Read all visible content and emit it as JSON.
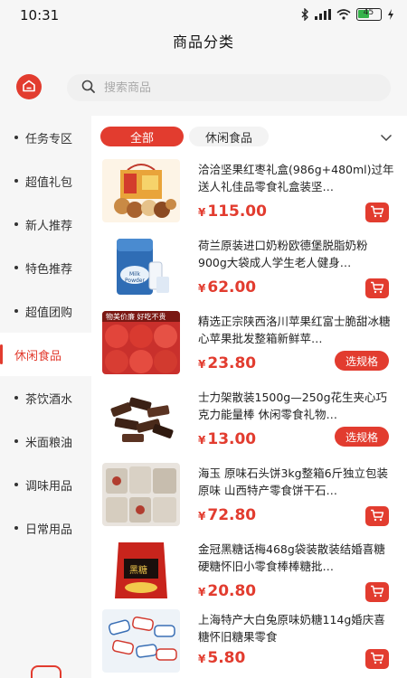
{
  "status": {
    "time": "10:31",
    "battery": "45"
  },
  "header": {
    "title": "商品分类"
  },
  "search": {
    "placeholder": "搜索商品"
  },
  "sidebar": {
    "items": [
      {
        "label": "任务专区"
      },
      {
        "label": "超值礼包"
      },
      {
        "label": "新人推荐"
      },
      {
        "label": "特色推荐"
      },
      {
        "label": "超值团购"
      },
      {
        "label": "休闲食品",
        "active": true
      },
      {
        "label": "茶饮酒水"
      },
      {
        "label": "米面粮油"
      },
      {
        "label": "调味用品"
      },
      {
        "label": "日常用品"
      }
    ]
  },
  "tabs": {
    "all": "全部",
    "current": "休闲食品"
  },
  "products": [
    {
      "title": "洽洽坚果红枣礼盒(986g+480ml)过年送人礼佳品零食礼盒装坚…",
      "currency": "¥",
      "price": "115.00",
      "action": "cart"
    },
    {
      "title": "荷兰原装进口奶粉欧德堡脱脂奶粉900g大袋成人学生老人健身…",
      "currency": "¥",
      "price": "62.00",
      "action": "cart"
    },
    {
      "title": "精选正宗陕西洛川苹果红富士脆甜冰糖心苹果批发整箱新鲜苹…",
      "currency": "¥",
      "price": "23.80",
      "action": "spec",
      "action_label": "选规格"
    },
    {
      "title": "士力架散装1500g—250g花生夹心巧克力能量棒 休闲零食礼物…",
      "currency": "¥",
      "price": "13.00",
      "action": "spec",
      "action_label": "选规格"
    },
    {
      "title": "海玉 原味石头饼3kg整箱6斤独立包装原味 山西特产零食饼干石…",
      "currency": "¥",
      "price": "72.80",
      "action": "cart"
    },
    {
      "title": "金冠黑糖话梅468g袋装散装结婚喜糖硬糖怀旧小零食棒棒糖批…",
      "currency": "¥",
      "price": "20.80",
      "action": "cart"
    },
    {
      "title": "上海特产大白兔原味奶糖114g婚庆喜糖怀旧糖果零食",
      "currency": "¥",
      "price": "5.80",
      "action": "cart"
    }
  ],
  "thumb_labels": {
    "milk": "Milk Powder",
    "apple_banner": "物美价廉 好吃不贵",
    "black_sugar": "黑糖"
  },
  "colors": {
    "accent": "#e23c2f",
    "sidebar_bg": "#f6f6f6"
  }
}
